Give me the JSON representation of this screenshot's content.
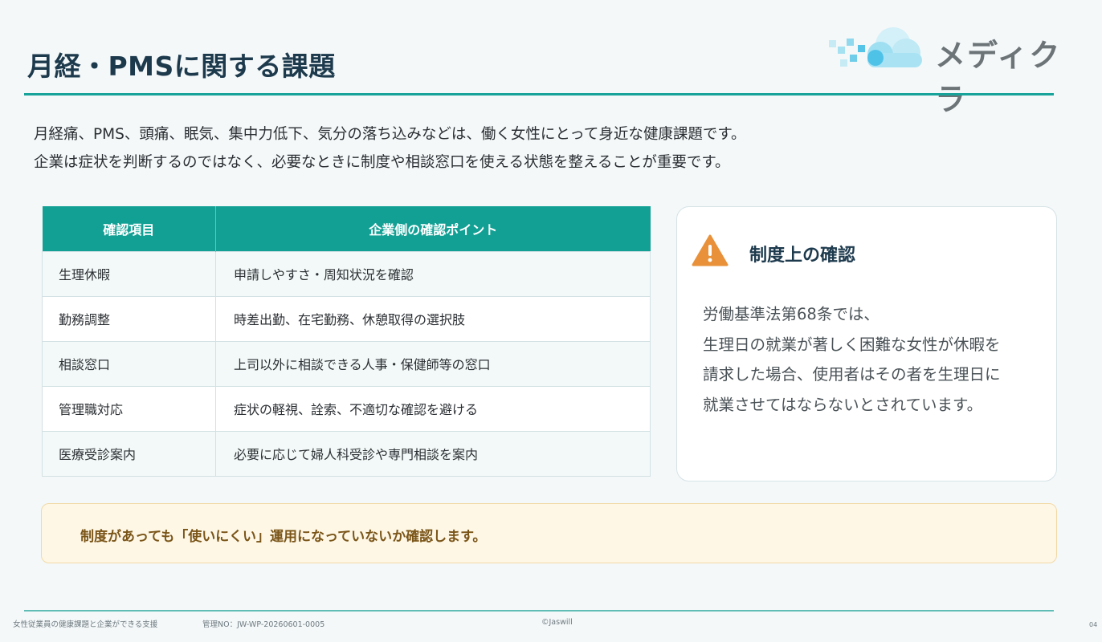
{
  "header": {
    "title": "月経・PMSに関する課題",
    "logo_text": "メディクラ"
  },
  "intro": {
    "line1": "月経痛、PMS、頭痛、眠気、集中力低下、気分の落ち込みなどは、働く女性にとって身近な健康課題です。",
    "line2": "企業は症状を判断するのではなく、必要なときに制度や相談窓口を使える状態を整えることが重要です。"
  },
  "table": {
    "headers": [
      "確認項目",
      "企業側の確認ポイント"
    ],
    "rows": [
      [
        "生理休暇",
        "申請しやすさ・周知状況を確認"
      ],
      [
        "勤務調整",
        "時差出勤、在宅勤務、休憩取得の選択肢"
      ],
      [
        "相談窓口",
        "上司以外に相談できる人事・保健師等の窓口"
      ],
      [
        "管理職対応",
        "症状の軽視、詮索、不適切な確認を避ける"
      ],
      [
        "医療受診案内",
        "必要に応じて婦人科受診や専門相談を案内"
      ]
    ]
  },
  "card": {
    "icon": "warning-icon",
    "title": "制度上の確認",
    "lines": [
      "労働基準法第68条では、",
      "生理日の就業が著しく困難な女性が休暇を",
      "請求した場合、使用者はその者を生理日に",
      "就業させてはならないとされています。"
    ]
  },
  "note": {
    "text": "制度があっても「使いにくい」運用になっていないか確認します。"
  },
  "footer": {
    "doc_title": "女性従業員の健康課題と企業ができる支援",
    "manage_no": "管理NO：JW-WP-20260601-0005",
    "copyright": "©Jaswill",
    "page": "04"
  },
  "colors": {
    "accent": "#12a094",
    "title": "#1d3a4d",
    "warning": "#e8913a",
    "note_bg": "#fef7e6",
    "note_text": "#7a5518"
  }
}
